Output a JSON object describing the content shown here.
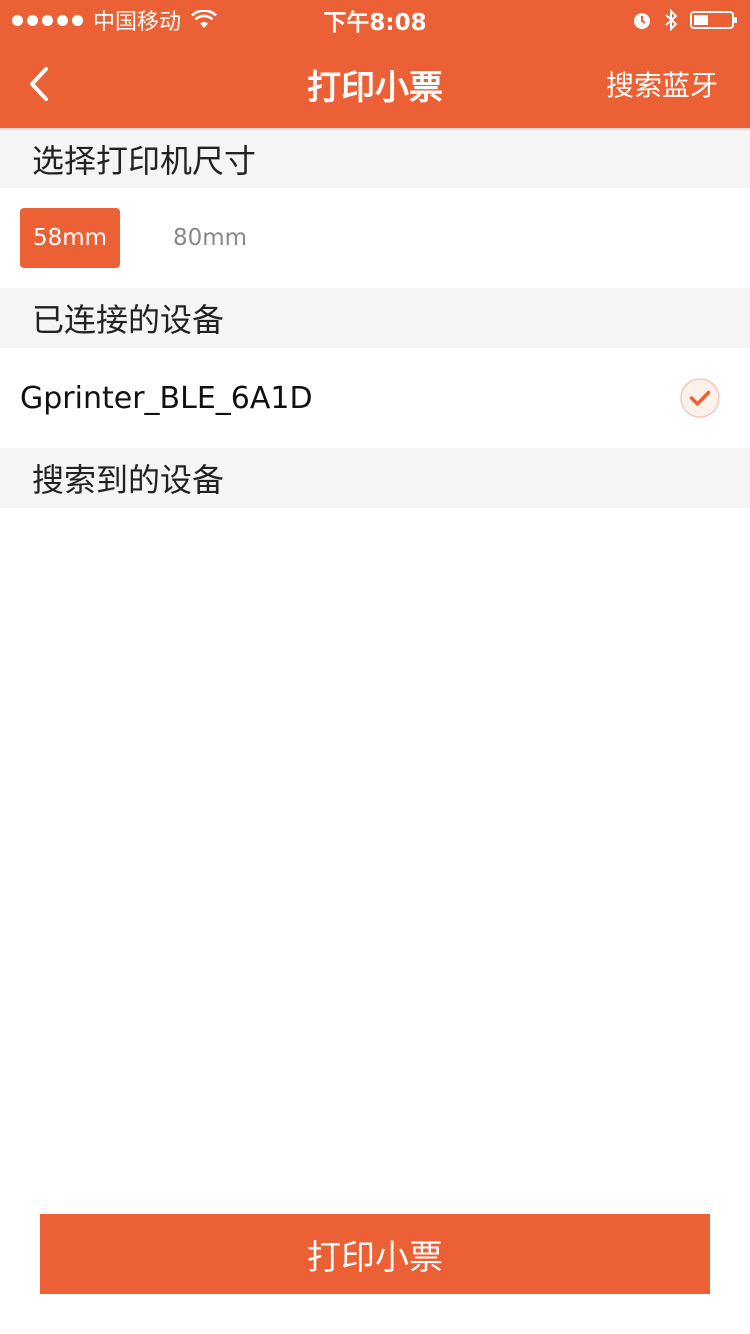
{
  "status_bar": {
    "carrier": "中国移动",
    "time": "下午8:08"
  },
  "nav": {
    "back_icon": "chevron-left-icon",
    "title": "打印小票",
    "action": "搜索蓝牙"
  },
  "sections": {
    "printer_size": "选择打印机尺寸",
    "connected": "已连接的设备",
    "found": "搜索到的设备"
  },
  "sizes": {
    "options": [
      "58mm",
      "80mm"
    ],
    "selected": "58mm"
  },
  "connected_device": {
    "name": "Gprinter_BLE_6A1D",
    "status_icon": "checkmark-icon"
  },
  "print_button": {
    "label": "打印小票"
  },
  "colors": {
    "accent": "#ec6035",
    "section_bg": "#f5f5f5"
  }
}
